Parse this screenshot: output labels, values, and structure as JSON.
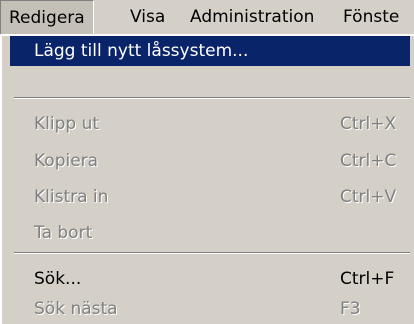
{
  "menubar": {
    "items": [
      {
        "label": "Redigera"
      },
      {
        "label": "Visa"
      },
      {
        "label": "Administration"
      },
      {
        "label": "Fönste"
      }
    ]
  },
  "menu": {
    "items": [
      {
        "label": "Lägg till nytt låssystem...",
        "shortcut": ""
      },
      {
        "label": "Klipp ut",
        "shortcut": "Ctrl+X"
      },
      {
        "label": "Kopiera",
        "shortcut": "Ctrl+C"
      },
      {
        "label": "Klistra in",
        "shortcut": "Ctrl+V"
      },
      {
        "label": "Ta bort",
        "shortcut": ""
      },
      {
        "label": "Sök...",
        "shortcut": "Ctrl+F"
      },
      {
        "label": "Sök nästa",
        "shortcut": "F3"
      }
    ]
  },
  "colors": {
    "menu_bg": "#d4d0c8",
    "highlight": "#0a246a",
    "disabled_text": "#808080"
  }
}
